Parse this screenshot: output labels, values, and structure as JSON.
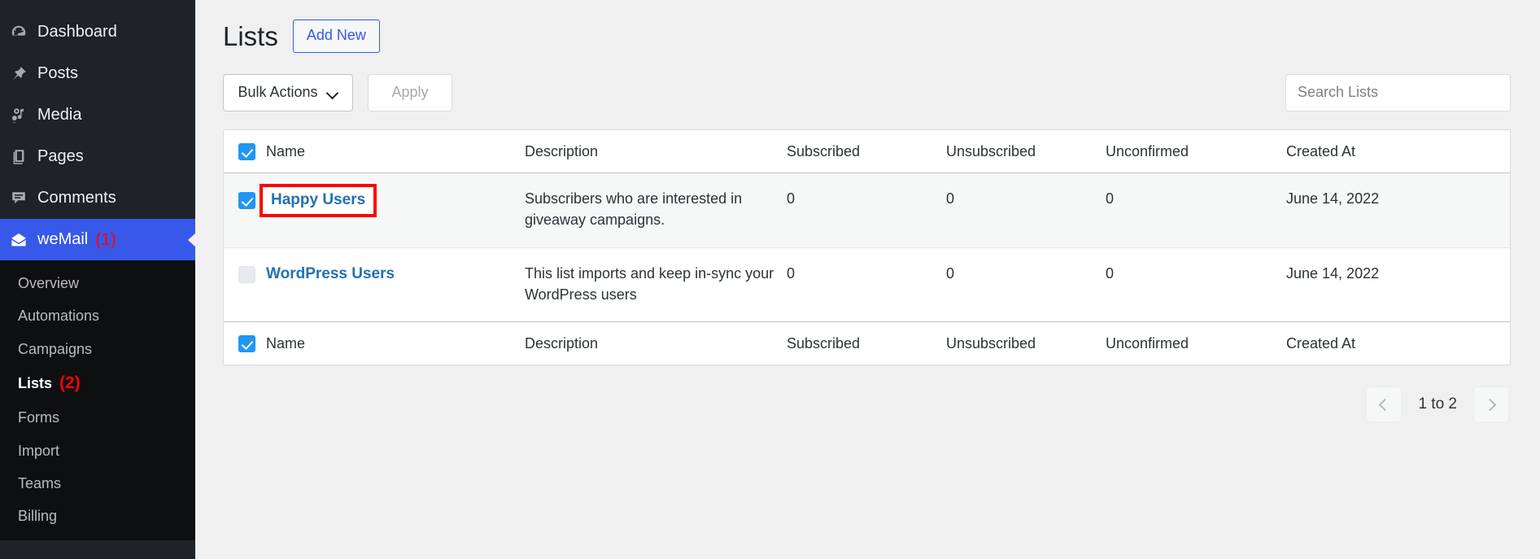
{
  "sidebar": {
    "items": [
      {
        "label": "Dashboard",
        "icon": "dashboard-icon",
        "active": false
      },
      {
        "label": "Posts",
        "icon": "posts-pin-icon",
        "active": false
      },
      {
        "label": "Media",
        "icon": "media-icon",
        "active": false
      },
      {
        "label": "Pages",
        "icon": "pages-icon",
        "active": false
      },
      {
        "label": "Comments",
        "icon": "comments-icon",
        "active": false
      },
      {
        "label": "weMail",
        "icon": "envelope-icon",
        "active": true,
        "badge": "(1)"
      }
    ],
    "submenu": [
      {
        "label": "Overview",
        "current": false
      },
      {
        "label": "Automations",
        "current": false
      },
      {
        "label": "Campaigns",
        "current": false
      },
      {
        "label": "Lists",
        "current": true,
        "badge": "(2)"
      },
      {
        "label": "Forms",
        "current": false
      },
      {
        "label": "Import",
        "current": false
      },
      {
        "label": "Teams",
        "current": false
      },
      {
        "label": "Billing",
        "current": false
      }
    ]
  },
  "header": {
    "title": "Lists",
    "add_new_label": "Add New"
  },
  "toolbar": {
    "bulk_actions_label": "Bulk Actions",
    "apply_label": "Apply",
    "search_placeholder": "Search Lists",
    "search_value": ""
  },
  "table": {
    "columns": [
      "Name",
      "Description",
      "Subscribed",
      "Unsubscribed",
      "Unconfirmed",
      "Created At"
    ],
    "rows": [
      {
        "checked": true,
        "highlighted": true,
        "name": "Happy Users",
        "description": "Subscribers who are interested in giveaway campaigns.",
        "subscribed": "0",
        "unsubscribed": "0",
        "unconfirmed": "0",
        "created_at": "June 14, 2022"
      },
      {
        "checked": false,
        "highlighted": false,
        "name": "WordPress Users",
        "description": "This list imports and keep in-sync your WordPress users",
        "subscribed": "0",
        "unsubscribed": "0",
        "unconfirmed": "0",
        "created_at": "June 14, 2022"
      }
    ]
  },
  "pagination": {
    "range_label": "1 to 2",
    "prev_icon": "chevron-left-icon",
    "next_icon": "chevron-right-icon"
  },
  "colors": {
    "sidebar_bg": "#1d2327",
    "submenu_bg": "#0d0f11",
    "active_blue": "#3858e9",
    "link_blue": "#2271b1",
    "checkbox_blue": "#2196f3",
    "badge_red": "#ff0000",
    "highlight_red": "#ff0000",
    "page_bg": "#f0f0f1"
  }
}
